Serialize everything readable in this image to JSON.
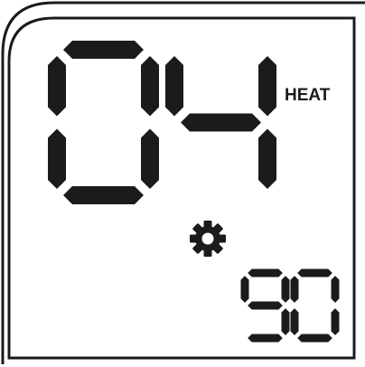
{
  "display": {
    "main_value": "04",
    "mode_label": "HEAT",
    "sub_value": "90",
    "icon": "gear-icon",
    "segment_color": "#1b1b1b",
    "background_color": "#ffffff"
  }
}
